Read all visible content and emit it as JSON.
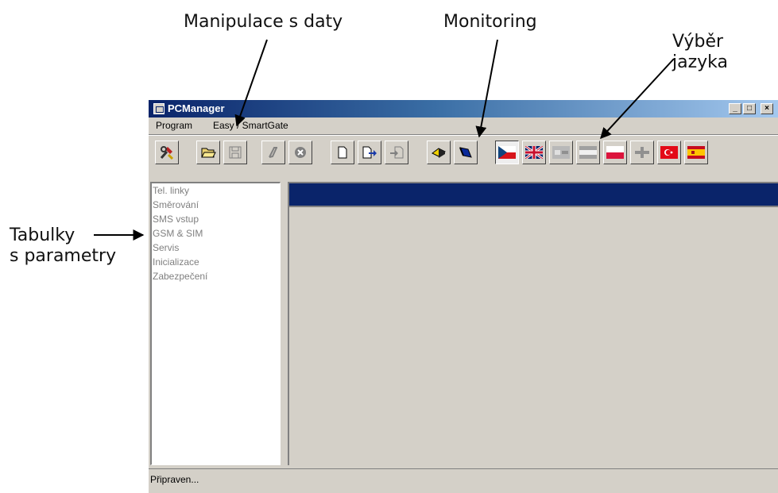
{
  "callouts": {
    "data_manipulation": "Manipulace s daty",
    "monitoring": "Monitoring",
    "language_line1": "Výběr",
    "language_line2": "jazyka",
    "tables_line1": "Tabulky",
    "tables_line2": "s parametry"
  },
  "window": {
    "title": "PCManager",
    "minimize": "_",
    "maximize": "□",
    "close": "×"
  },
  "menu": [
    "Program",
    "Easy / SmartGate"
  ],
  "toolbar": {
    "buttons": [
      "tools-icon",
      "open-folder-icon",
      "save-icon",
      "link-icon",
      "cancel-icon",
      "new-document-icon",
      "export-icon",
      "import-icon",
      "monitor-open-icon",
      "monitor-book-icon"
    ],
    "languages": [
      "flag-cz-icon",
      "flag-uk-icon",
      "flag-grey-icon",
      "flag-grey-stripes-icon",
      "flag-pl-icon",
      "flag-grey-cross-icon",
      "flag-tr-icon",
      "flag-es-icon"
    ]
  },
  "tree": [
    "Tel. linky",
    "Směrování",
    "SMS vstup",
    "GSM & SIM",
    "Servis",
    "Inicializace",
    "Zabezpečení"
  ],
  "status": "Připraven...",
  "colors": {
    "title_blue": "#0a246a",
    "face": "#d4d0c8",
    "disabled_text": "#808080"
  }
}
